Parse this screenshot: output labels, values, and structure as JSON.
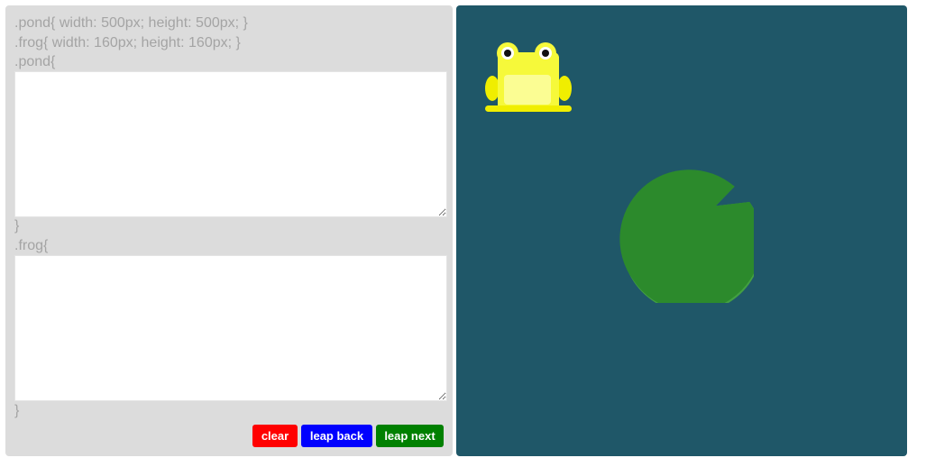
{
  "editor": {
    "hint_pond": ".pond{ width: 500px; height: 500px; }",
    "hint_frog": ".frog{ width: 160px; height: 160px; }",
    "pond_open": ".pond{",
    "pond_close": "}",
    "frog_open": ".frog{",
    "frog_close": "}",
    "pond_value": "",
    "frog_value": ""
  },
  "buttons": {
    "clear": "clear",
    "back": "leap back",
    "next": "leap next"
  },
  "colors": {
    "editor_bg": "#dcdcdc",
    "pond_bg": "#1f5768",
    "frog_body": "#f6f93a",
    "frog_belly": "#fbfd93",
    "lilypad": "#2c8a2c",
    "lilypad_edge": "#43a042",
    "clear": "#ff0000",
    "back": "#0000ff",
    "next": "#008000"
  },
  "icons": {
    "frog": "frog-icon",
    "lilypad": "lilypad-icon"
  }
}
